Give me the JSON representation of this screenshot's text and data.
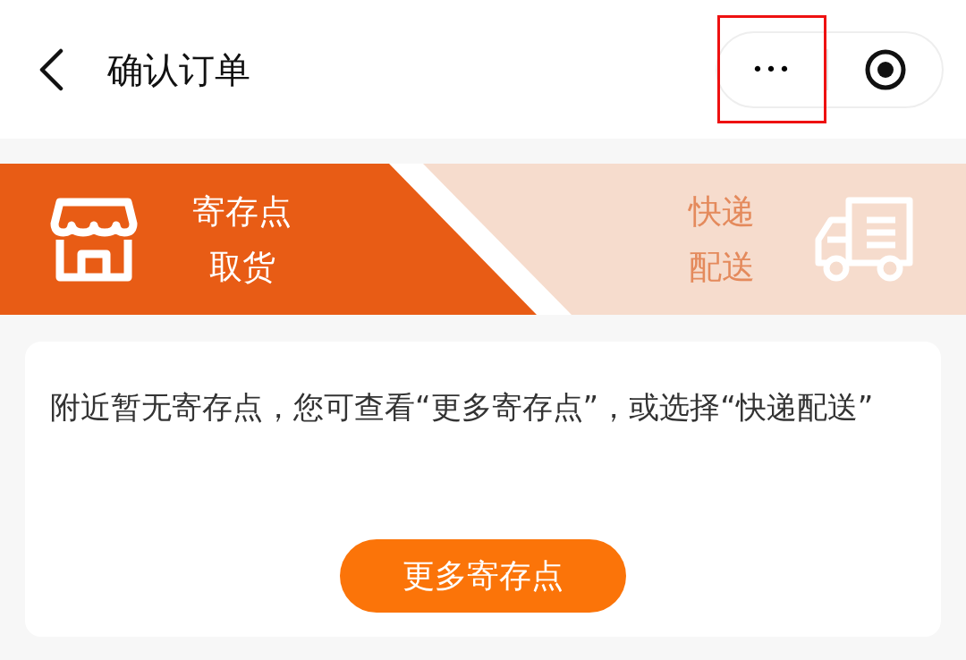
{
  "header": {
    "title": "确认订单",
    "more_button": {
      "label": "•••",
      "highlighted": true
    }
  },
  "tabs": [
    {
      "kind": "pickup",
      "lines": [
        "寄存点",
        "取货"
      ],
      "selected": true
    },
    {
      "kind": "delivery",
      "lines": [
        "快递",
        "配送"
      ],
      "selected": false
    }
  ],
  "notice": {
    "message": "附近暂无寄存点，您可查看“更多寄存点”，或选择“快递配送”",
    "button": "更多寄存点"
  }
}
